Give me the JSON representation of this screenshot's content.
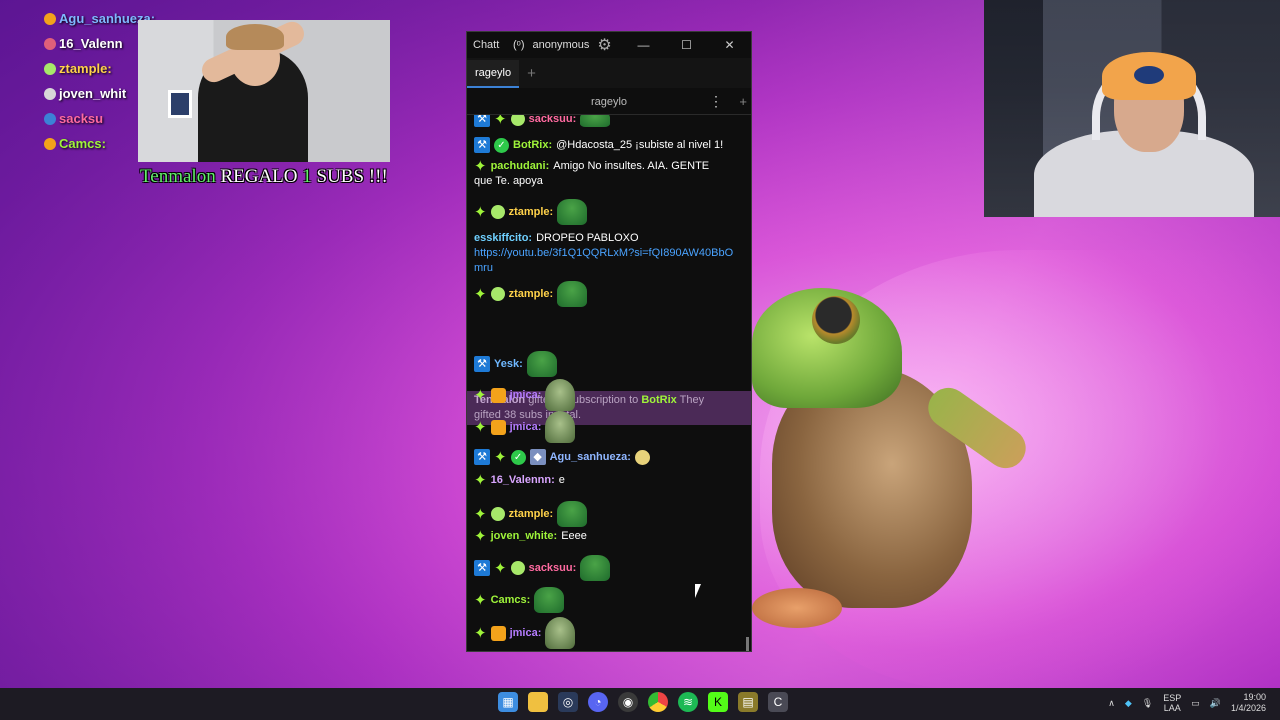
{
  "overlay_chat": [
    {
      "name": "Agu_sanhueza:",
      "color": "#7fb8ff",
      "icon_color": "#f3a21b"
    },
    {
      "name": "16_Valenn",
      "color": "#ffffff",
      "icon_color": "#e0607a"
    },
    {
      "name": "ztample:",
      "color": "#ffd24a",
      "icon_color": "#a7e86a"
    },
    {
      "name": "joven_whit",
      "color": "#ffffff",
      "icon_color": "#d8d8d8"
    },
    {
      "name": "sacksu",
      "color": "#ff6aa0",
      "icon_color": "#3c82d6"
    },
    {
      "name": "Camcs:",
      "color": "#9ff43a",
      "icon_color": "#f3a21b"
    }
  ],
  "gift_banner": {
    "user": "Tenmalon",
    "text1": "REGALO",
    "count": "1",
    "text2": "SUBS !!!"
  },
  "window": {
    "title": "Chatt",
    "status": "(ᵒ)",
    "user": "anonymous",
    "minimize": "—",
    "maximize": "☐",
    "close": "✕",
    "tab": "rageylo",
    "channel": "rageylo"
  },
  "messages": [
    {
      "user": "sacksuu:",
      "color": "#ff6aa0"
    },
    {
      "user": "BotRix:",
      "color": "#9ff43a",
      "text": "@Hdacosta_25 ¡subiste al nivel 1!"
    },
    {
      "user": "pachudani:",
      "color": "#9ff43a",
      "text": "Amigo No insultes. AIA. GENTE",
      "text2": "que Te. apoya"
    },
    {
      "user": "ztample:",
      "color": "#ffd24a"
    },
    {
      "user": "esskiffcito:",
      "color": "#6fd0ff",
      "text": "DROPEO PABLOXO",
      "link": "https://youtu.be/3f1Q1QQRLxM?si=fQI890AW40BbOmru"
    },
    {
      "user": "ztample:",
      "color": "#ffd24a"
    },
    {
      "user": "Yesk:",
      "color": "#6fb8ff"
    },
    {
      "user": "jmica:",
      "color": "#b57cff"
    },
    {
      "user": "jmica:",
      "color": "#b57cff"
    },
    {
      "user": "Agu_sanhueza:",
      "color": "#8fb6ff"
    },
    {
      "user": "16_Valennn:",
      "color": "#d9a6ff",
      "text": "e"
    },
    {
      "user": "ztample:",
      "color": "#ffd24a"
    },
    {
      "user": "joven_white:",
      "color": "#9ff43a",
      "text": "Eeee"
    },
    {
      "user": "sacksuu:",
      "color": "#ff6aa0"
    },
    {
      "user": "Camcs:",
      "color": "#9ff43a"
    },
    {
      "user": "jmica:",
      "color": "#b57cff"
    }
  ],
  "gift_notice": {
    "user": "Tenmalon",
    "text1": "gifted 1 subscription to",
    "target": "BotRix",
    "text2": "They",
    "text3": "gifted 38 subs in total."
  },
  "taskbar": {
    "apps": [
      "windows-start",
      "file-explorer",
      "steam",
      "discord",
      "obs",
      "chrome",
      "spotify",
      "kick",
      "game",
      "chatterino"
    ],
    "lang_top": "ESP",
    "lang_bottom": "LAA",
    "time": "19:00",
    "date": "1/4/2026"
  }
}
